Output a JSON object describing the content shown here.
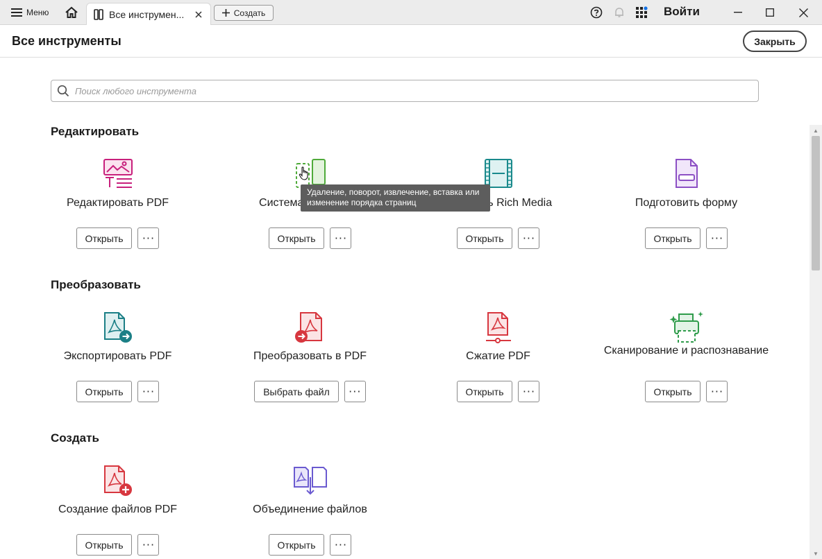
{
  "titlebar": {
    "menu_label": "Меню",
    "tab_title": "Все инструмен...",
    "new_tab_label": "Создать",
    "signin_label": "Войти"
  },
  "header": {
    "title": "Все инструменты",
    "close_label": "Закрыть"
  },
  "search": {
    "placeholder": "Поиск любого инструмента"
  },
  "sections": {
    "edit": "Редактировать",
    "convert": "Преобразовать",
    "create": "Создать"
  },
  "tools": {
    "edit_pdf": {
      "label": "Редактировать PDF",
      "action": "Открыть"
    },
    "organize": {
      "label": "Систематизировать",
      "action": "Открыть"
    },
    "rich_media": {
      "label": "Добавить Rich Media",
      "action": "Открыть"
    },
    "prepare_form": {
      "label": "Подготовить форму",
      "action": "Открыть"
    },
    "export_pdf": {
      "label": "Экспортировать PDF",
      "action": "Открыть"
    },
    "convert_pdf": {
      "label": "Преобразовать в PDF",
      "action": "Выбрать файл"
    },
    "compress_pdf": {
      "label": "Сжатие PDF",
      "action": "Открыть"
    },
    "scan_ocr": {
      "label": "Сканирование и распознавание",
      "action": "Открыть"
    },
    "create_pdf": {
      "label": "Создание файлов PDF",
      "action": "Открыть"
    },
    "combine": {
      "label": "Объединение файлов",
      "action": "Открыть"
    }
  },
  "more_label": "···",
  "tooltip": "Удаление, поворот, извлечение, вставка или изменение порядка страниц",
  "colors": {
    "edit_pink": "#c8207c",
    "organize_green": "#4faa3a",
    "media_teal": "#1a8a8c",
    "form_purple": "#8c4fc4",
    "export_teal": "#1b7f86",
    "pdf_red": "#d7373f",
    "scan_green": "#2e9b4a",
    "combine_purple": "#6a5ad0"
  }
}
